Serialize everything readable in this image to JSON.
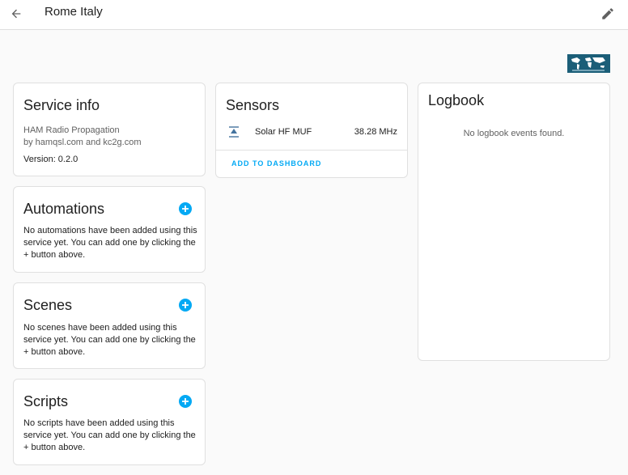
{
  "header": {
    "back_icon": "arrow-left-icon",
    "title": "Rome Italy",
    "edit_icon": "pencil-icon"
  },
  "logo": {
    "name": "hamqsl-world-map-logo",
    "text": "HAM RADIO PROPAGATION"
  },
  "service_info": {
    "title": "Service info",
    "model": "HAM Radio Propagation",
    "manufacturer": "by hamqsl.com and kc2g.com",
    "version": "Version: 0.2.0"
  },
  "automations": {
    "title": "Automations",
    "text": "No automations have been added using this service yet. You can add one by clicking the + button above.",
    "add_icon": "plus-circle-icon"
  },
  "scenes": {
    "title": "Scenes",
    "text": "No scenes have been added using this service yet. You can add one by clicking the + button above.",
    "add_icon": "plus-circle-icon"
  },
  "scripts": {
    "title": "Scripts",
    "text": "No scripts have been added using this service yet. You can add one by clicking the + button above.",
    "add_icon": "plus-circle-icon"
  },
  "sensors": {
    "title": "Sensors",
    "items": [
      {
        "icon": "antenna-icon",
        "name": "Solar HF MUF",
        "value": "38.28 MHz"
      }
    ],
    "add_to_dashboard": "ADD TO DASHBOARD"
  },
  "logbook": {
    "title": "Logbook",
    "empty_text": "No logbook events found."
  },
  "colors": {
    "accent": "#03a9f4",
    "header_bg": "#ffffff",
    "page_bg": "#fafafa",
    "logo_bg": "#1b5e78"
  }
}
